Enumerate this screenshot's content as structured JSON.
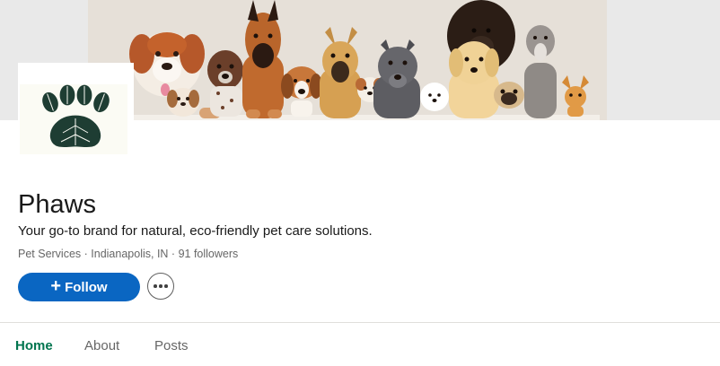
{
  "company": {
    "name": "Phaws",
    "tagline": "Your go-to brand for natural, eco-friendly pet care solutions.",
    "industry": "Pet Services",
    "location": "Indianapolis, IN",
    "followers": "91 followers",
    "separator": " · "
  },
  "actions": {
    "follow_icon": "+",
    "follow_label": "Follow",
    "more_icon": "more-horizontal-icon"
  },
  "tabs": [
    {
      "label": "Home",
      "active": true
    },
    {
      "label": "About",
      "active": false
    },
    {
      "label": "Posts",
      "active": false
    }
  ],
  "colors": {
    "primary_button": "#0a66c2",
    "active_tab": "#01754f",
    "logo_leaf": "#1e3d33"
  },
  "banner": {
    "icon": "cartoon-dogs-banner"
  },
  "logo": {
    "icon": "leaf-paw-print-logo"
  }
}
